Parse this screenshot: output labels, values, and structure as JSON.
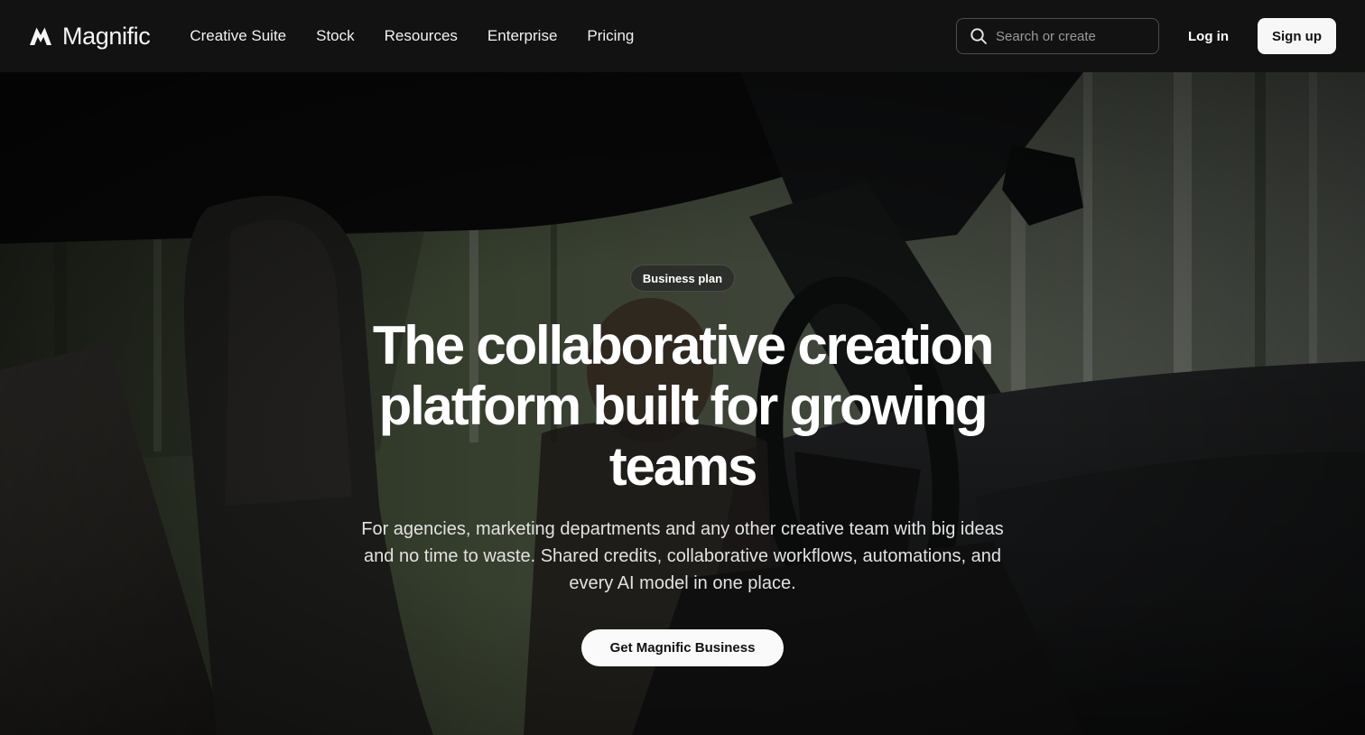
{
  "brand": {
    "name": "Magnific",
    "logo_icon": "magnific-m-logo"
  },
  "nav": {
    "items": [
      {
        "label": "Creative Suite"
      },
      {
        "label": "Stock"
      },
      {
        "label": "Resources"
      },
      {
        "label": "Enterprise"
      },
      {
        "label": "Pricing"
      }
    ]
  },
  "header": {
    "search_placeholder": "Search or create",
    "search_icon": "search-icon",
    "login_label": "Log in",
    "signup_label": "Sign up"
  },
  "hero": {
    "badge": "Business plan",
    "headline": "The collaborative creation platform built for growing teams",
    "subtext": "For agencies, marketing departments and any other creative team with big ideas and no time to waste. Shared credits, collaborative workflows, automations, and every AI model in one place.",
    "cta_label": "Get Magnific Business",
    "background": "car-interior-forest-photo"
  },
  "colors": {
    "header_bg": "#121212",
    "button_bg": "#f7f7f7",
    "button_text": "#111111"
  }
}
